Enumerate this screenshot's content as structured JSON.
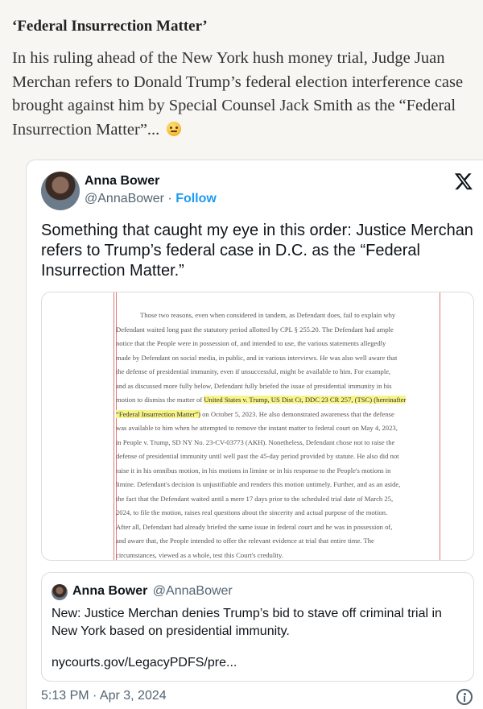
{
  "article": {
    "heading": "‘Federal Insurrection Matter’",
    "body_lines": [
      "In his ruling ahead of the New York hush money trial, Judge Juan",
      "Merchan refers to Donald Trump’s federal election interference case",
      "brought against him by Special Counsel Jack Smith as the “Federal",
      "Insurrection Matter”..."
    ],
    "emoji": "thinking-face-icon"
  },
  "tweet": {
    "author_name": "Anna Bower",
    "author_handle": "@AnnaBower",
    "separator": " · ",
    "follow_label": "Follow",
    "text": "Something that caught my eye in this order: Justice Merchan refers to Trump’s federal case in D.C. as the “Federal Insurrection Matter.”",
    "timestamp": "5:13 PM · Apr 3, 2024",
    "document": {
      "lines": [
        "Those two reasons, even when considered in tandem, as Defendant does, fail to explain why",
        "Defendant waited long past the statutory period allotted by CPL § 255.20. The Defendant had ample",
        "notice that the People were in possession of, and intended to use, the various statements allegedly",
        "made by Defendant on social media, in public, and in various interviews. He was also well aware that",
        "the defense of presidential immunity, even if unsuccessful, might be available to him. For example,",
        "and as discussed more fully below, Defendant fully briefed the issue of presidential immunity in his",
        "motion to dismiss the matter of United States v. Trump, US Dist Ct, DDC 23 CR 257, (TSC) (hereinafter",
        "“Federal Insurrection Matter”) on October 5, 2023. He also demonstrated awareness that the defense",
        "was available to him when he attempted to remove the instant matter to federal court on May 4, 2023,",
        "in People v. Trump, SD NY No. 23-CV-03773 (AKH). Nonetheless, Defendant chose not to raise the",
        "defense of presidential immunity until well past the 45-day period provided by statute. He also did not",
        "raise it in his omnibus motion, in his motions in limine or in his response to the People's motions in",
        "limine. Defendant's decision is unjustifiable and renders this motion untimely. Further, and as an aside,",
        "the fact that the Defendant waited until a mere 17 days prior to the scheduled trial date of March 25,",
        "2024, to file the motion, raises real questions about the sincerity and actual purpose of the motion.",
        "After all, Defendant had already briefed the same issue in federal court and he was in possession of,",
        "and aware that, the People intended to offer the relevant evidence at trial that entire time. The",
        "circumstances, viewed as a whole, test this Court's credulity."
      ],
      "highlight_line6_plain": "motion to dismiss the matter of ",
      "highlight_line6_marked": "United States v. Trump, US Dist Ct, DDC 23 CR 257, (TSC) (hereinafter",
      "highlight_line7_marked": "“Federal Insurrection Matter”)",
      "highlight_line7_rest": " on October 5, 2023. He also demonstrated awareness that the defense"
    },
    "quote": {
      "author_name": "Anna Bower",
      "author_handle": "@AnnaBower",
      "text": "New: Justice Merchan denies Trump’s bid to stave off criminal trial in New York based on presidential immunity.",
      "link": "nycourts.gov/LegacyPDFS/pre..."
    }
  }
}
